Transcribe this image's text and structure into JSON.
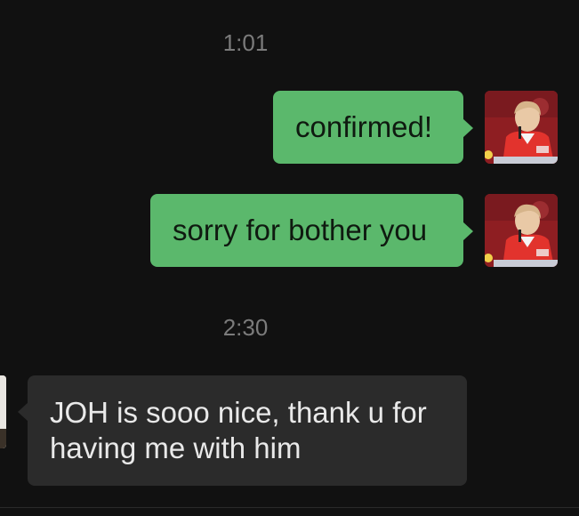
{
  "messages": [
    {
      "type": "time",
      "text": "1:01"
    },
    {
      "type": "outgoing",
      "text": "confirmed!"
    },
    {
      "type": "outgoing",
      "text": "sorry for bother you"
    },
    {
      "type": "time",
      "text": "2:30"
    },
    {
      "type": "incoming",
      "text": "JOH is sooo nice, thank u for having me with him"
    }
  ],
  "colors": {
    "background": "#111111",
    "outgoing_bubble": "#5bb86c",
    "incoming_bubble": "#2b2b2b",
    "timestamp": "#7b7b7b"
  },
  "icons": {
    "self_avatar": "profile-photo",
    "contact_avatar": "profile-photo"
  }
}
